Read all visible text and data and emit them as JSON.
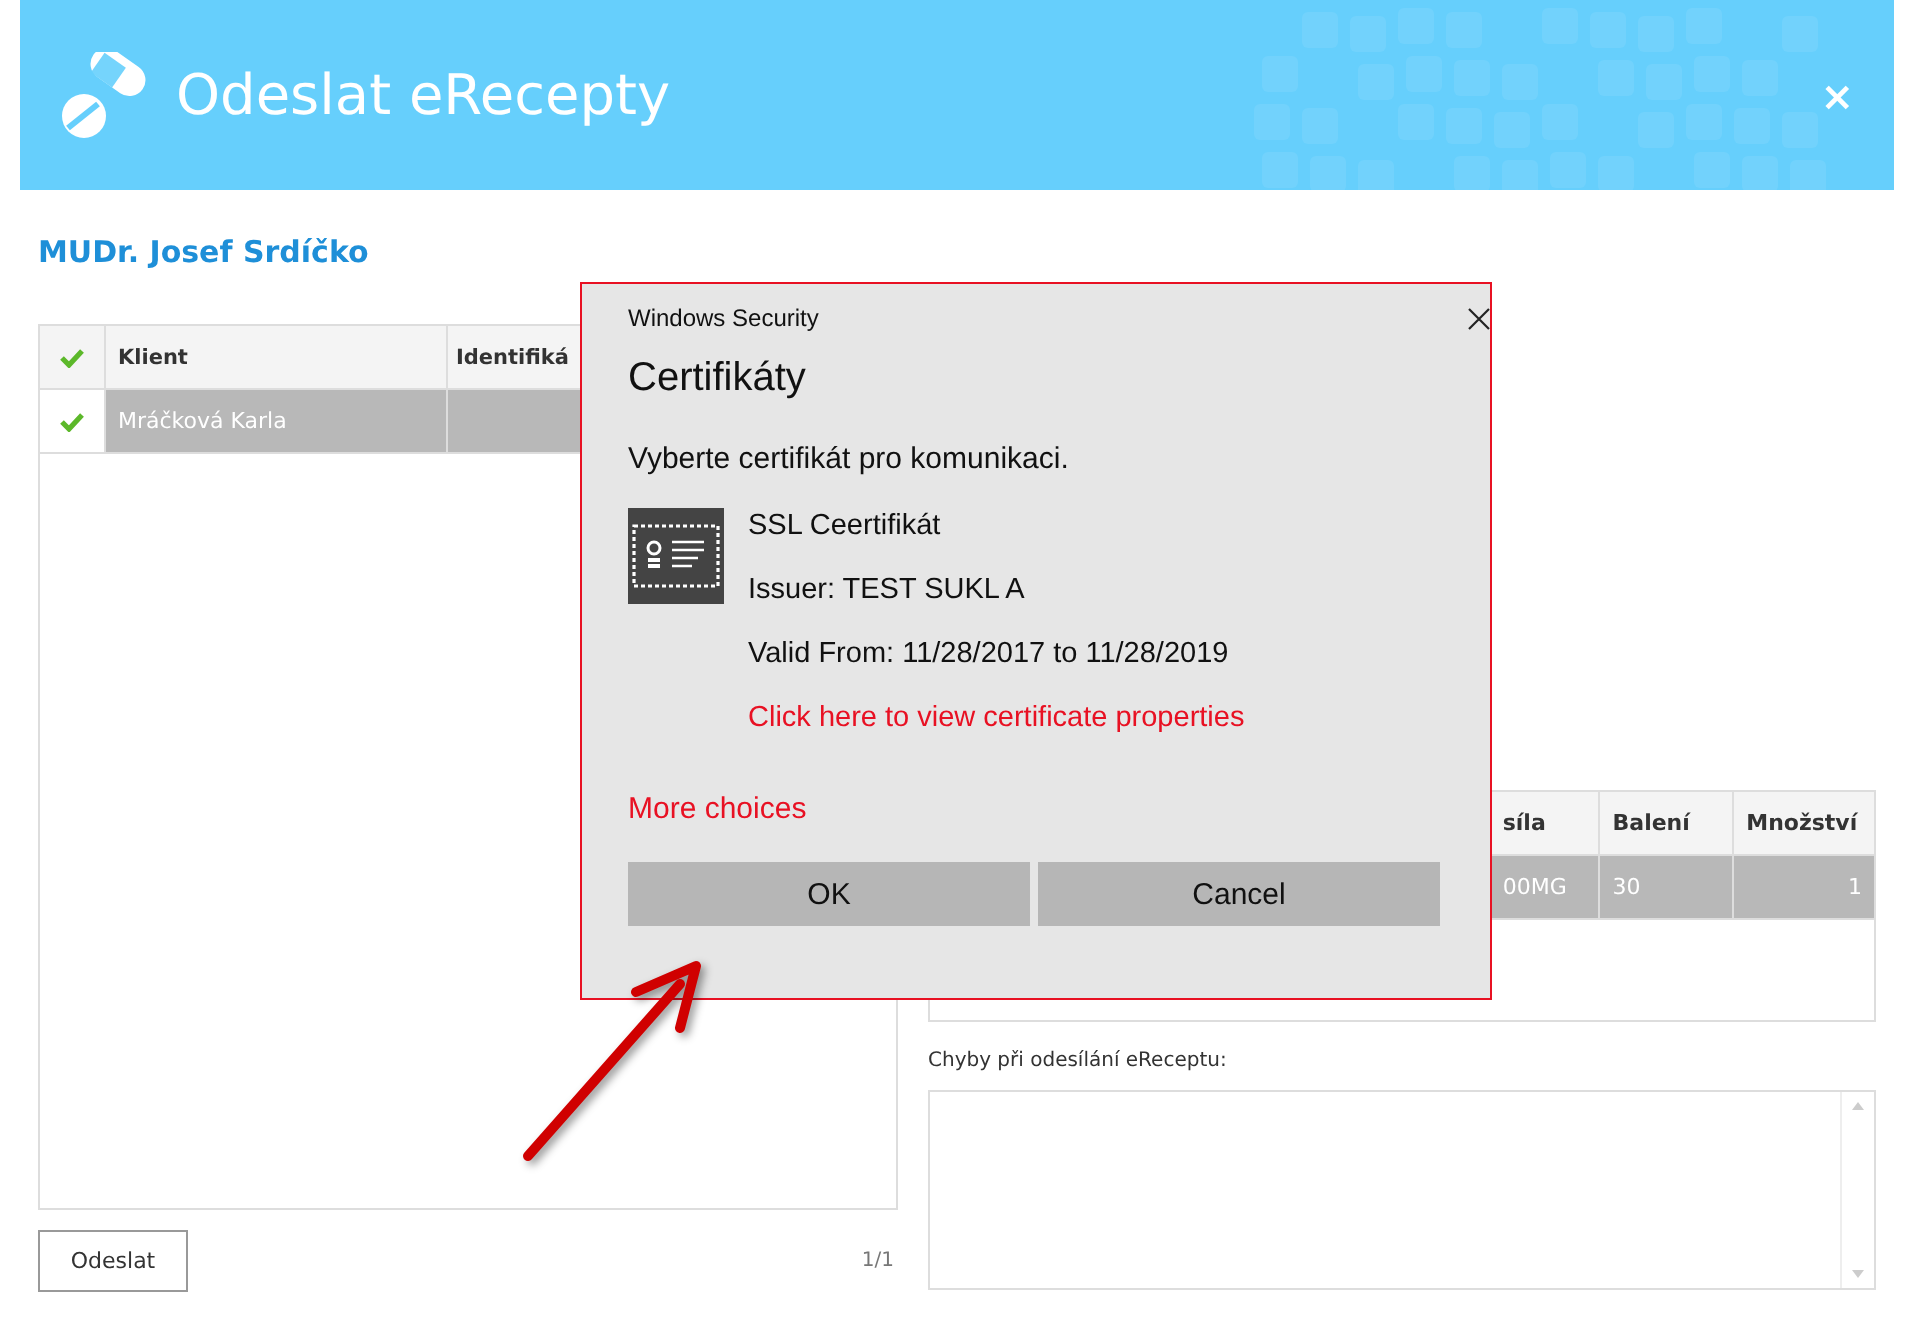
{
  "window": {
    "title": "Odeslat eRecepty",
    "close": "×"
  },
  "doctor": "MUDr. Josef Srdíčko",
  "clients_table": {
    "header_checked": true,
    "columns": [
      "Klient",
      "Identifiká"
    ],
    "rows": [
      {
        "checked": true,
        "selected": true,
        "cells": [
          "Mráčková Karla"
        ]
      }
    ]
  },
  "send_button": "Odeslat",
  "pager": "1/1",
  "items_table": {
    "columns": [
      "síla",
      "Balení",
      "Množství"
    ],
    "rows": [
      {
        "selected": true,
        "cells": [
          "00MG",
          "30",
          "1"
        ]
      }
    ]
  },
  "errors": {
    "label": "Chyby při odesílání eReceptu:"
  },
  "dialog": {
    "caption": "Windows Security",
    "title": "Certifikáty",
    "prompt": "Vyberte certifikát pro komunikaci.",
    "certificate": {
      "name": "SSL Ceertifikát",
      "issuer": "Issuer: TEST SUKL A",
      "valid": "Valid From: 11/28/2017 to 11/28/2019",
      "link": "Click here to view certificate properties"
    },
    "more": "More choices",
    "buttons": [
      "OK",
      "Cancel"
    ]
  }
}
